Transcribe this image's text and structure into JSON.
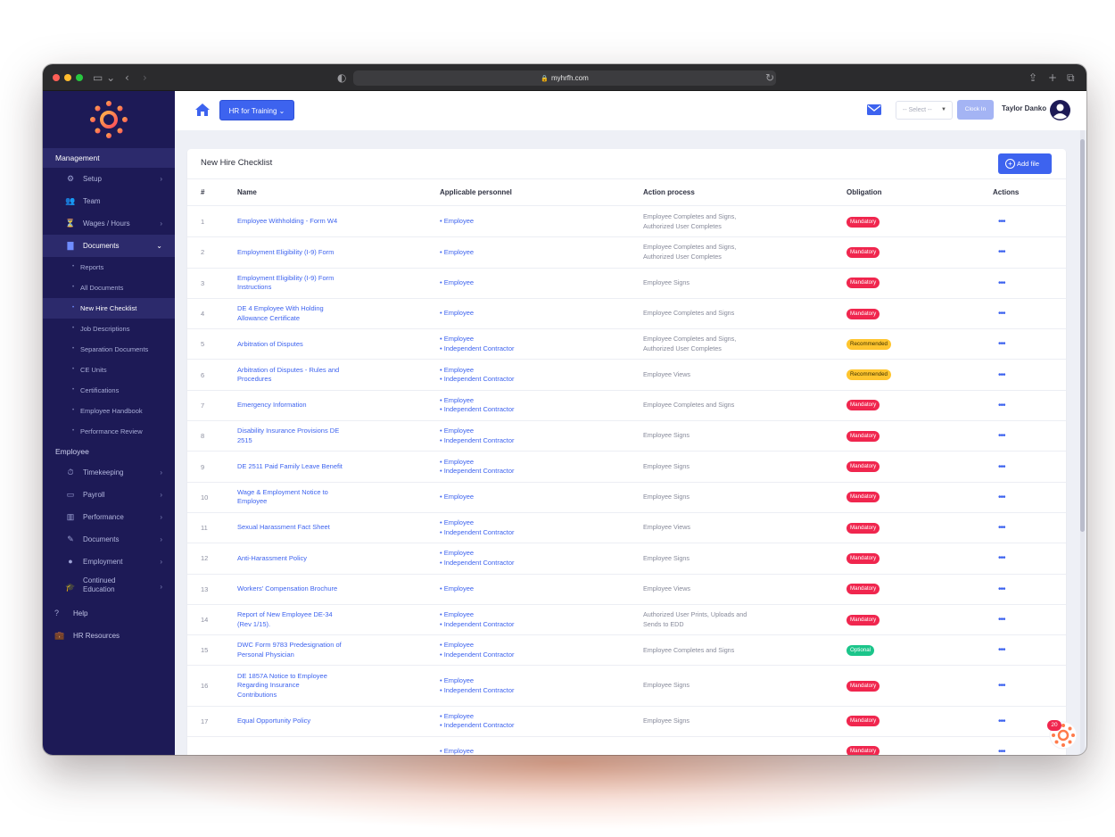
{
  "browser": {
    "url": "myhrfh.com"
  },
  "sidebar": {
    "management_label": "Management",
    "management_items": [
      {
        "label": "Setup",
        "icon": "gears-icon"
      },
      {
        "label": "Team",
        "icon": "team-icon"
      },
      {
        "label": "Wages / Hours",
        "icon": "hourglass-icon"
      },
      {
        "label": "Documents",
        "icon": "document-icon",
        "expanded": true
      }
    ],
    "document_subitems": [
      "Reports",
      "All Documents",
      "New Hire Checklist",
      "Job Descriptions",
      "Separation Documents",
      "CE Units",
      "Certifications",
      "Employee Handbook",
      "Performance Review"
    ],
    "active_subitem": "New Hire Checklist",
    "employee_label": "Employee",
    "employee_items": [
      {
        "label": "Timekeeping",
        "icon": "stopwatch-icon"
      },
      {
        "label": "Payroll",
        "icon": "money-icon"
      },
      {
        "label": "Performance",
        "icon": "chart-icon"
      },
      {
        "label": "Documents",
        "icon": "file-signature-icon"
      },
      {
        "label": "Employment",
        "icon": "person-icon"
      },
      {
        "label": "Continued Education",
        "icon": "graduation-cap-icon"
      }
    ],
    "root_items": [
      {
        "label": "Help",
        "icon": "help-icon"
      },
      {
        "label": "HR Resources",
        "icon": "briefcase-icon"
      }
    ]
  },
  "topbar": {
    "company_button": "HR for Training",
    "select_placeholder": "-- Select --",
    "clock_in": "Clock In",
    "user_name": "Taylor Danko"
  },
  "page": {
    "title": "New Hire Checklist",
    "add_file": "Add file",
    "columns": [
      "#",
      "Name",
      "Applicable personnel",
      "Action process",
      "Obligation",
      "Actions"
    ],
    "rows": [
      {
        "num": "1",
        "name": [
          "Employee Withholding - Form W4"
        ],
        "personnel": [
          "Employee"
        ],
        "action": [
          "Employee Completes and Signs,",
          "Authorized User Completes"
        ],
        "obligation": "Mandatory"
      },
      {
        "num": "2",
        "name": [
          "Employment Eligibility (I-9) Form"
        ],
        "personnel": [
          "Employee"
        ],
        "action": [
          "Employee Completes and Signs,",
          "Authorized User Completes"
        ],
        "obligation": "Mandatory"
      },
      {
        "num": "3",
        "name": [
          "Employment Eligibility (I-9) Form",
          "Instructions"
        ],
        "personnel": [
          "Employee"
        ],
        "action": [
          "Employee Signs"
        ],
        "obligation": "Mandatory"
      },
      {
        "num": "4",
        "name": [
          "DE 4 Employee With Holding",
          "Allowance Certificate"
        ],
        "personnel": [
          "Employee"
        ],
        "action": [
          "Employee Completes and Signs"
        ],
        "obligation": "Mandatory"
      },
      {
        "num": "5",
        "name": [
          "Arbitration of Disputes"
        ],
        "personnel": [
          "Employee",
          "Independent Contractor"
        ],
        "action": [
          "Employee Completes and Signs,",
          "Authorized User Completes"
        ],
        "obligation": "Recommended"
      },
      {
        "num": "6",
        "name": [
          "Arbitration of Disputes - Rules and",
          "Procedures"
        ],
        "personnel": [
          "Employee",
          "Independent Contractor"
        ],
        "action": [
          "Employee Views"
        ],
        "obligation": "Recommended"
      },
      {
        "num": "7",
        "name": [
          "Emergency Information"
        ],
        "personnel": [
          "Employee",
          "Independent Contractor"
        ],
        "action": [
          "Employee Completes and Signs"
        ],
        "obligation": "Mandatory"
      },
      {
        "num": "8",
        "name": [
          "Disability Insurance Provisions DE",
          "2515"
        ],
        "personnel": [
          "Employee",
          "Independent Contractor"
        ],
        "action": [
          "Employee Signs"
        ],
        "obligation": "Mandatory"
      },
      {
        "num": "9",
        "name": [
          "DE 2511 Paid Family Leave Benefit"
        ],
        "personnel": [
          "Employee",
          "Independent Contractor"
        ],
        "action": [
          "Employee Signs"
        ],
        "obligation": "Mandatory"
      },
      {
        "num": "10",
        "name": [
          "Wage & Employment Notice to",
          "Employee"
        ],
        "personnel": [
          "Employee"
        ],
        "action": [
          "Employee Signs"
        ],
        "obligation": "Mandatory"
      },
      {
        "num": "11",
        "name": [
          "Sexual Harassment Fact Sheet"
        ],
        "personnel": [
          "Employee",
          "Independent Contractor"
        ],
        "action": [
          "Employee Views"
        ],
        "obligation": "Mandatory"
      },
      {
        "num": "12",
        "name": [
          "Anti-Harassment Policy"
        ],
        "personnel": [
          "Employee",
          "Independent Contractor"
        ],
        "action": [
          "Employee Signs"
        ],
        "obligation": "Mandatory"
      },
      {
        "num": "13",
        "name": [
          "Workers' Compensation Brochure"
        ],
        "personnel": [
          "Employee"
        ],
        "action": [
          "Employee Views"
        ],
        "obligation": "Mandatory"
      },
      {
        "num": "14",
        "name": [
          "Report of New Employee DE-34",
          "(Rev 1/15)."
        ],
        "personnel": [
          "Employee",
          "Independent Contractor"
        ],
        "action": [
          "Authorized User Prints, Uploads and",
          "Sends to EDD"
        ],
        "obligation": "Mandatory"
      },
      {
        "num": "15",
        "name": [
          "DWC Form 9783 Predesignation of",
          "Personal Physician"
        ],
        "personnel": [
          "Employee",
          "Independent Contractor"
        ],
        "action": [
          "Employee Completes and Signs"
        ],
        "obligation": "Optional"
      },
      {
        "num": "16",
        "name": [
          "DE 1857A Notice to Employee",
          "Regarding Insurance",
          "Contributions"
        ],
        "personnel": [
          "Employee",
          "Independent Contractor"
        ],
        "action": [
          "Employee Signs"
        ],
        "obligation": "Mandatory"
      },
      {
        "num": "17",
        "name": [
          "Equal Opportunity Policy"
        ],
        "personnel": [
          "Employee",
          "Independent Contractor"
        ],
        "action": [
          "Employee Signs"
        ],
        "obligation": "Mandatory"
      },
      {
        "num": "",
        "name": [
          ""
        ],
        "personnel": [
          "Employee"
        ],
        "action": [
          ""
        ],
        "obligation": "Mandatory"
      }
    ],
    "actions_icon": "more-dots-icon",
    "notification_count": "20"
  },
  "colors": {
    "sidebar_bg": "#1d1a56",
    "primary": "#3d63ef",
    "mandatory": "#f0264e",
    "recommended": "#ffc52e",
    "optional": "#1bc58a"
  }
}
